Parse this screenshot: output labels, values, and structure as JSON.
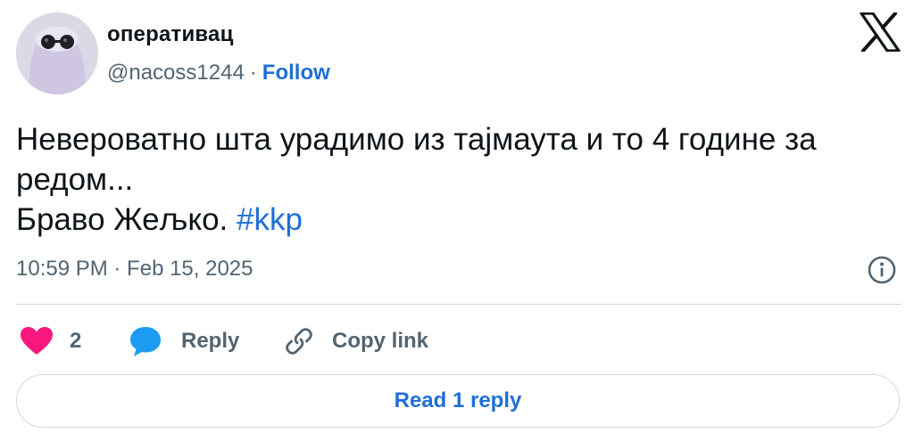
{
  "user": {
    "display_name": "оперативац",
    "handle": "@nacoss1244",
    "separator": "·",
    "follow_label": "Follow"
  },
  "tweet": {
    "line1": "Невероватно шта урадимо из тајмаута и то 4 године за",
    "line2": "редом...",
    "line3_text": "Браво Жељко.",
    "hashtag": "#kkp",
    "timestamp": "10:59 PM · Feb 15, 2025"
  },
  "actions": {
    "like_count": "2",
    "reply_label": "Reply",
    "copy_link_label": "Copy link"
  },
  "read_replies_label": "Read 1 reply",
  "colors": {
    "link": "#1d6fd6",
    "like": "#f91880",
    "reply": "#1d9bf0",
    "muted": "#536471",
    "border": "#cfd9de"
  },
  "icons": {
    "logo": "x-logo-icon",
    "info": "info-icon",
    "like": "heart-icon",
    "reply": "speech-bubble-icon",
    "copy": "link-icon"
  }
}
